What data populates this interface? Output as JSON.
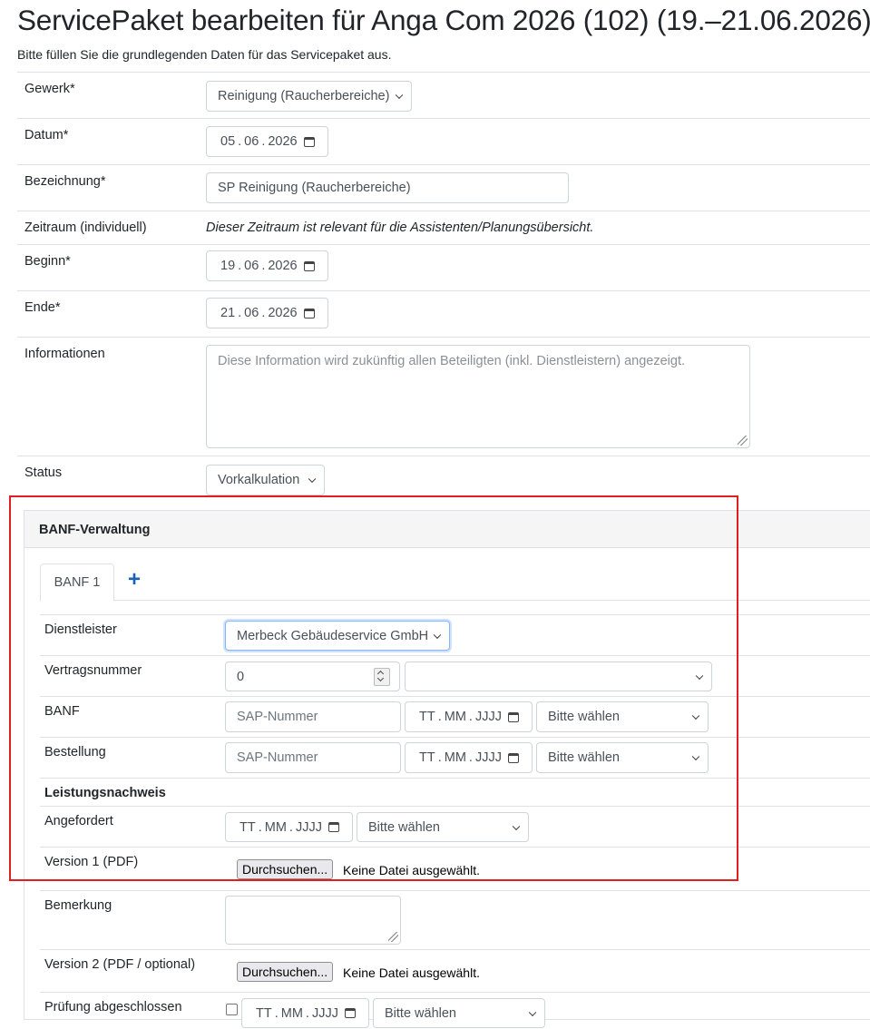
{
  "page": {
    "title": "ServicePaket bearbeiten für Anga Com 2026 (102) (19.–21.06.2026)",
    "intro": "Bitte füllen Sie die grundlegenden Daten für das Servicepaket aus."
  },
  "form": {
    "gewerk": {
      "label": "Gewerk*",
      "value": "Reinigung (Raucherbereiche)"
    },
    "datum": {
      "label": "Datum*",
      "day": "05",
      "month": "06",
      "year": "2026"
    },
    "bezeichnung": {
      "label": "Bezeichnung*",
      "value": "SP Reinigung (Raucherbereiche)"
    },
    "zeitraum": {
      "label": "Zeitraum (individuell)",
      "note": "Dieser Zeitraum ist relevant für die Assistenten/Planungsübersicht."
    },
    "beginn": {
      "label": "Beginn*",
      "day": "19",
      "month": "06",
      "year": "2026"
    },
    "ende": {
      "label": "Ende*",
      "day": "21",
      "month": "06",
      "year": "2026"
    },
    "informationen": {
      "label": "Informationen",
      "placeholder": "Diese Information wird zukünftig allen Beteiligten (inkl. Dienstleistern) angezeigt."
    },
    "status": {
      "label": "Status",
      "value": "Vorkalkulation"
    }
  },
  "banf": {
    "header": "BANF-Verwaltung",
    "tab_label": "BANF 1",
    "add_symbol": "+",
    "date_placeholder": {
      "day": "TT",
      "month": "MM",
      "year": "JJJJ"
    },
    "select_placeholder": "Bitte wählen",
    "sap_placeholder": "SAP-Nummer",
    "file_button": "Durchsuchen...",
    "file_none": "Keine Datei ausgewählt.",
    "dienstleister": {
      "label": "Dienstleister",
      "value": "Merbeck Gebäudeservice GmbH"
    },
    "vertragsnummer": {
      "label": "Vertragsnummer",
      "value": "0"
    },
    "banf_row": {
      "label": "BANF"
    },
    "bestellung": {
      "label": "Bestellung"
    },
    "leistungsnachweis": {
      "label": "Leistungsnachweis"
    },
    "angefordert": {
      "label": "Angefordert"
    },
    "version1": {
      "label": "Version 1 (PDF)"
    },
    "bemerkung": {
      "label": "Bemerkung"
    },
    "version2": {
      "label": "Version 2 (PDF / optional)"
    },
    "pruefung": {
      "label": "Prüfung abgeschlossen"
    }
  }
}
